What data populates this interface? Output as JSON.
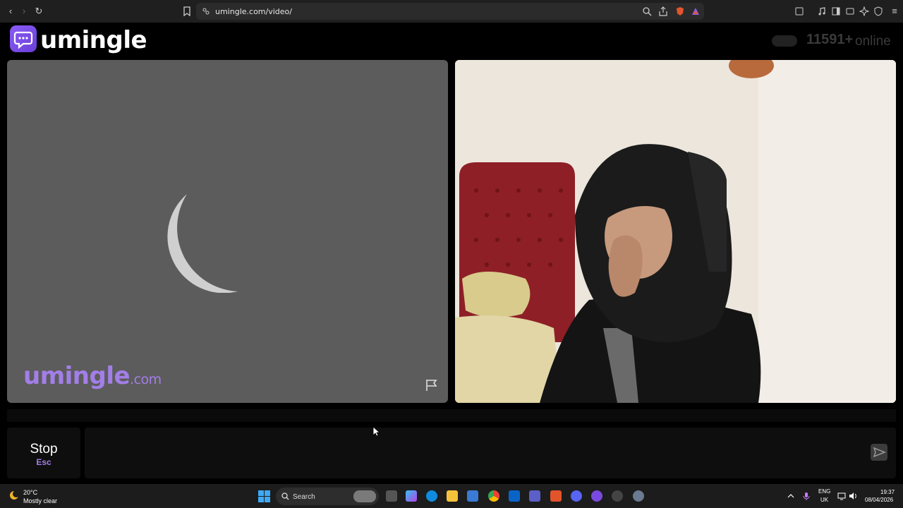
{
  "browser": {
    "url": "umingle.com/video/"
  },
  "header": {
    "logo_text": "umingle",
    "online_count": "11591+",
    "online_label": "online"
  },
  "video": {
    "watermark_main": "umingle",
    "watermark_domain": ".com"
  },
  "controls": {
    "stop_label": "Stop",
    "stop_key": "Esc",
    "chat_placeholder": ""
  },
  "taskbar": {
    "weather_temp": "20°C",
    "weather_desc": "Mostly clear",
    "search_label": "Search",
    "lang_top": "ENG",
    "lang_bottom": "UK",
    "time": "19:37",
    "date": "08/04/2026"
  },
  "colors": {
    "brand_purple": "#8a5cf6",
    "watermark_purple": "#a37ee8"
  }
}
